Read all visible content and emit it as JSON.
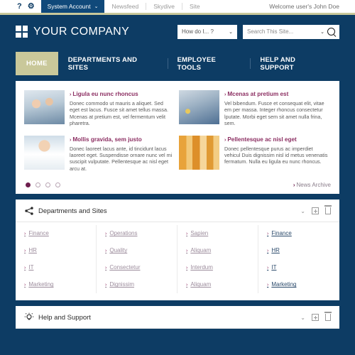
{
  "suitebar": {
    "help_icon": "question-mark-icon",
    "settings_icon": "gear-icon",
    "account_label": "System Account",
    "account_chevron": "⌄",
    "links": [
      "Newsfeed",
      "Skydive",
      "Site"
    ],
    "welcome": "Welcome user's John Doe"
  },
  "header": {
    "logo_text": "YOUR COMPANY",
    "how_do_i": {
      "label": "How do I... ?",
      "chevron": "⌄"
    },
    "search": {
      "placeholder": "Search This Site...",
      "value": "Search This Site...",
      "chevron": "⌄",
      "icon": "search-icon"
    }
  },
  "nav": {
    "active": "HOME",
    "items": [
      "HOME",
      "DEPARTMENTS AND SITES",
      "EMPLOYEE TOOLS",
      "HELP AND SUPPORT"
    ]
  },
  "news": {
    "items": [
      {
        "title": "Ligula eu nunc rhoncus",
        "desc": "Donec commodo ut mauris a aliquet. Sed eget est lacus. Fusce sit amet tellus massa. Mcenas at pretium est, vel fermentum velit pharetra.",
        "thumb": "laboratory-team-photo"
      },
      {
        "title": "Mcenas at pretium est",
        "desc": "Vel bibendum. Fusce et consequat elit, vitae em per massa. Integer rhoncus consectetur lputate. Morbi eget sem sit amet nulla frina, sem.",
        "thumb": "lab-technician-photo"
      },
      {
        "title": "Mollis gravida, sem justo",
        "desc": "Donec laoreet lacus ante, id tincidunt lacus laoreet eget. Suspendisse ornare nunc vel mi suscipit vulputate. Pellentesque ac nisl eget arcu at.",
        "thumb": "doctor-portrait-photo"
      },
      {
        "title": "Pellentesque ac nisl eget",
        "desc": "Donec pellentesque purus ac imperdiet vehicul Duis dignissim nisl id metus venenatis fermatum. Nulla eu ligula eu nunc rhoncus.",
        "thumb": "pill-bottles-photo"
      }
    ],
    "arrow": "›",
    "dots": [
      true,
      false,
      false,
      false
    ],
    "archive_label": "News Archive",
    "archive_arrow": "›"
  },
  "departments": {
    "icon": "share-icon",
    "title": "Departments and Sites",
    "actions": {
      "collapse": "chevron-down-icon",
      "add": "add-icon",
      "delete": "trash-icon",
      "chevron_glyph": "⌄"
    },
    "arrow": "›",
    "columns": [
      {
        "accent": false,
        "links": [
          "Finance",
          "HR",
          "IT",
          "Marketing"
        ]
      },
      {
        "accent": false,
        "links": [
          "Operations",
          "Quality",
          "Consectetur",
          "Dignissim"
        ]
      },
      {
        "accent": false,
        "links": [
          "Sapien",
          "Aliquam",
          "Interdum",
          "Aliquam"
        ]
      },
      {
        "accent": true,
        "links": [
          "Finance",
          "HR",
          "IT",
          "Marketing"
        ]
      }
    ]
  },
  "help": {
    "icon": "lightbulb-icon",
    "title": "Help and Support",
    "actions": {
      "collapse": "chevron-down-icon",
      "add": "add-icon",
      "delete": "trash-icon",
      "chevron_glyph": "⌄"
    }
  },
  "colors": {
    "page_bg": "#0d3c64",
    "accent_khaki": "#c9c89a",
    "link_magenta": "#8c2f62",
    "panel_bg": "#ffffff"
  }
}
